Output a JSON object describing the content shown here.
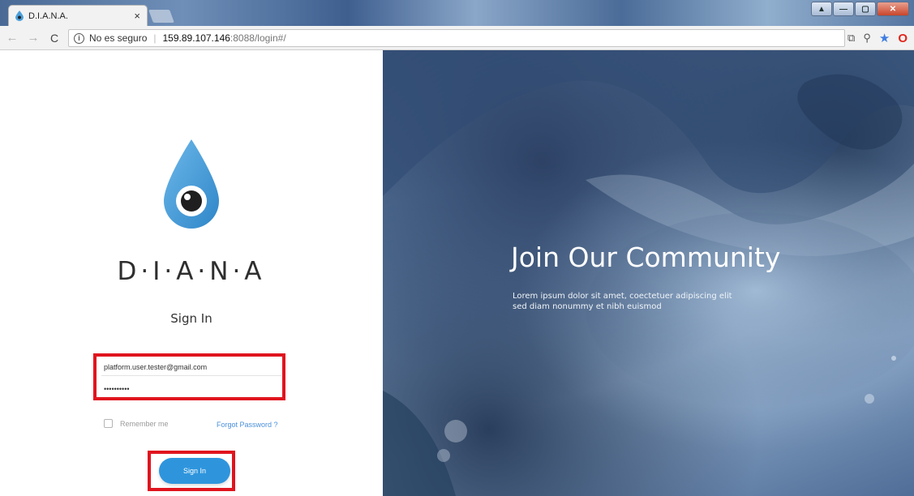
{
  "browser": {
    "tab_title": "D.I.A.N.A.",
    "tab_close": "×",
    "security_label": "No es seguro",
    "url_host": "159.89.107.146",
    "url_rest": ":8088/login#/"
  },
  "login": {
    "brand": "D·I·A·N·A",
    "title": "Sign In",
    "email_value": "platform.user.tester@gmail.com",
    "password_value": "••••••••••",
    "remember_label": "Remember me",
    "forgot_label": "Forgot Password ?",
    "submit_label": "Sign In"
  },
  "hero": {
    "title": "Join Our Community",
    "subtitle": "Lorem ipsum dolor sit amet, coectetuer adipiscing elit sed diam nonummy et nibh euismod"
  },
  "colors": {
    "accent_blue": "#2e95dd",
    "highlight_red": "#e0141e",
    "drop_blue": "#4aa0dc"
  }
}
